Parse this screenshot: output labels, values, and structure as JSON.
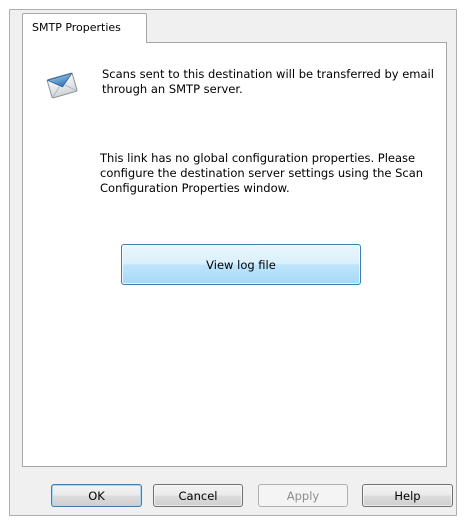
{
  "tab": {
    "label": "SMTP Properties"
  },
  "content": {
    "icon": "email-envelope-icon",
    "intro_text": "Scans sent to this destination will be transferred by email through an SMTP server.",
    "info_text": "This link has no global configuration properties. Please configure the destination server settings using the Scan Configuration Properties window.",
    "view_log_label": "View log file"
  },
  "buttons": {
    "ok_label": "OK",
    "cancel_label": "Cancel",
    "apply_label": "Apply",
    "help_label": "Help",
    "apply_enabled": false
  },
  "colors": {
    "dialog_background": "#f0f0f0",
    "panel_background": "#ffffff",
    "accent_border": "#3c7fb1",
    "disabled_text": "#8d8d8d"
  }
}
